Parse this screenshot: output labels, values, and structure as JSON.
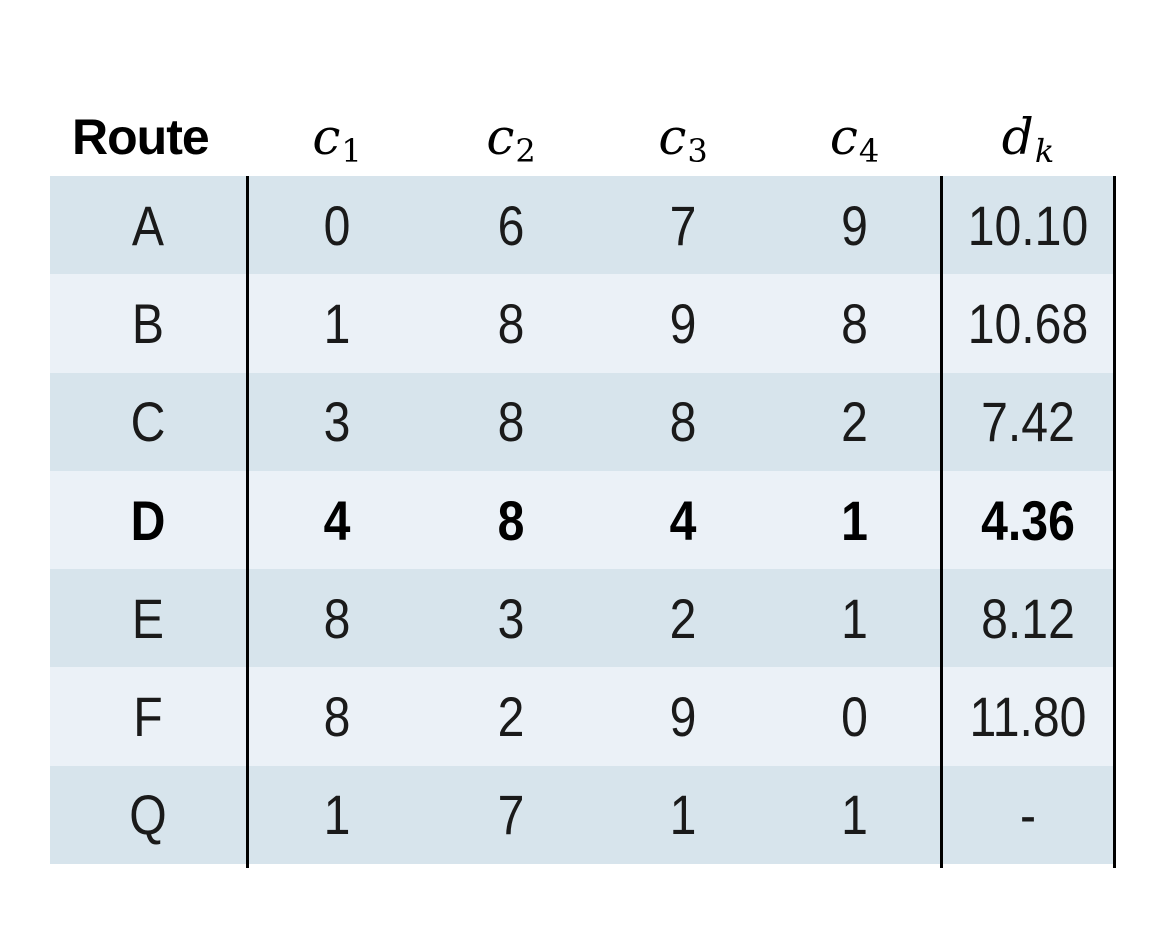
{
  "table": {
    "headers": {
      "route": "Route",
      "c1": {
        "base": "c",
        "sub": "1"
      },
      "c2": {
        "base": "c",
        "sub": "2"
      },
      "c3": {
        "base": "c",
        "sub": "3"
      },
      "c4": {
        "base": "c",
        "sub": "4"
      },
      "dk": {
        "base": "d",
        "sub": "k"
      }
    },
    "rows": [
      {
        "route": "A",
        "c1": "0",
        "c2": "6",
        "c3": "7",
        "c4": "9",
        "dk": "10.10",
        "bold": false
      },
      {
        "route": "B",
        "c1": "1",
        "c2": "8",
        "c3": "9",
        "c4": "8",
        "dk": "10.68",
        "bold": false
      },
      {
        "route": "C",
        "c1": "3",
        "c2": "8",
        "c3": "8",
        "c4": "2",
        "dk": "7.42",
        "bold": false
      },
      {
        "route": "D",
        "c1": "4",
        "c2": "8",
        "c3": "4",
        "c4": "1",
        "dk": "4.36",
        "bold": true
      },
      {
        "route": "E",
        "c1": "8",
        "c2": "3",
        "c3": "2",
        "c4": "1",
        "dk": "8.12",
        "bold": false
      },
      {
        "route": "F",
        "c1": "8",
        "c2": "2",
        "c3": "9",
        "c4": "0",
        "dk": "11.80",
        "bold": false
      },
      {
        "route": "Q",
        "c1": "1",
        "c2": "7",
        "c3": "1",
        "c4": "1",
        "dk": "-",
        "bold": false
      }
    ],
    "colors": {
      "shaded_row": "#d7e4ec",
      "light_row": "#ebf1f7",
      "rule": "#000000"
    }
  }
}
